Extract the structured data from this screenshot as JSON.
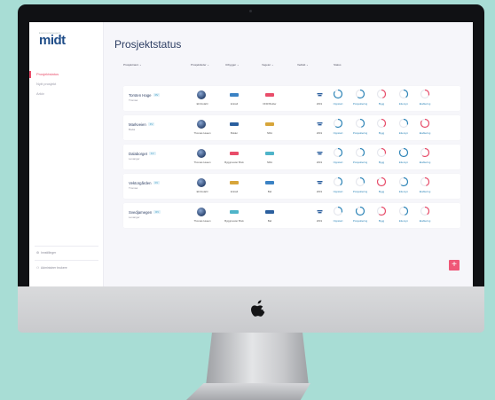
{
  "app": {
    "logo_small": "kommunevegen",
    "logo": "midt",
    "title": "Prosjektstatus"
  },
  "sidebar": {
    "items": [
      {
        "label": "Prosjektstatus",
        "active": true
      },
      {
        "label": "Nytt prosjekt",
        "active": false
      },
      {
        "label": "Arkiv",
        "active": false
      }
    ],
    "footer": [
      {
        "label": "Innstillinger",
        "icon": "gear-icon"
      },
      {
        "label": "Administrer brukere",
        "icon": "users-icon"
      }
    ]
  },
  "table": {
    "headers": [
      "Prosjektnavn",
      "Prosjektleder",
      "Utbygger",
      "Vegeier",
      "Vedtatt",
      "Status"
    ],
    "stage_labels": [
      "Oppstart",
      "Prosjektering",
      "Bygg",
      "Ettersyn",
      "Etablering"
    ],
    "rows": [
      {
        "name": "Torsten Hage",
        "tag": "RV",
        "sub": "Tromsø",
        "leader": "Eli Rodahl",
        "builder": "Entrall",
        "owner": "DNR Bolder",
        "date": "2019"
      },
      {
        "name": "Markveien",
        "tag": "FV",
        "sub": "Bodø",
        "leader": "Thomas Heaon",
        "builder": "Bolder",
        "owner": "NRA",
        "date": "2019"
      },
      {
        "name": "Dalaborget",
        "tag": "FV",
        "sub": "Levanger",
        "leader": "Thomas Heaon",
        "builder": "Byggmester Bruk",
        "owner": "NRA",
        "date": "2019"
      },
      {
        "name": "Vektorgården",
        "tag": "FV",
        "sub": "Tromsø",
        "leader": "Eli Rodahl",
        "builder": "Entrall",
        "owner": "Bøl",
        "date": "2019"
      },
      {
        "name": "Svedjamegen",
        "tag": "RV",
        "sub": "Levanger",
        "leader": "Thomas Heaon",
        "builder": "Byggmester Bruk",
        "owner": "Bøl",
        "date": "2019"
      }
    ]
  },
  "colors": {
    "accent": "#e94d6a",
    "brand": "#1f4d88",
    "gauge_done": "#2f86b8",
    "gauge_warn": "#e94d6a",
    "gauge_bg": "#e6e8ee"
  },
  "fab_label": "+"
}
